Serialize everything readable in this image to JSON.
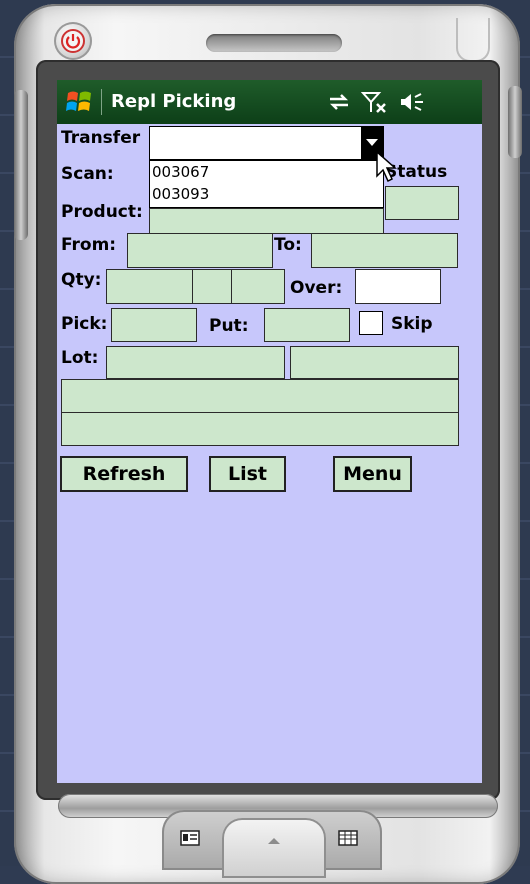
{
  "window": {
    "title": "Repl Picking"
  },
  "status_icons": [
    "sync-arrows-icon",
    "signal-off-icon",
    "speaker-icon"
  ],
  "form": {
    "transfer_label": "Transfer",
    "transfer_value": "",
    "transfer_options": [
      "003067",
      "003093"
    ],
    "scan_label": "Scan:",
    "status_label": "Status",
    "product_label": "Product:",
    "from_label": "From:",
    "to_label": "To:",
    "qty_label": "Qty:",
    "over_label": "Over:",
    "pick_label": "Pick:",
    "put_label": "Put:",
    "skip_label": "Skip",
    "skip_checked": false,
    "lot_label": "Lot:"
  },
  "buttons": {
    "refresh": "Refresh",
    "list": "List",
    "menu": "Menu"
  },
  "colors": {
    "title_bar": "#0d3f18",
    "screen_bg": "#c7c7fb",
    "field_bg": "#cde7cc"
  }
}
